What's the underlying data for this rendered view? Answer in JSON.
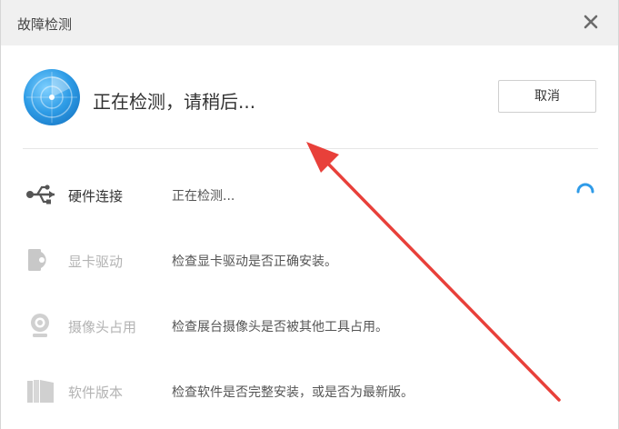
{
  "window": {
    "title": "故障检测",
    "close_icon": "close-icon"
  },
  "header": {
    "status_text": "正在检测，请稍后...",
    "cancel_label": "取消",
    "radar_icon": "radar-icon"
  },
  "checks": [
    {
      "icon": "usb-icon",
      "label": "硬件连接",
      "description": "正在检测...",
      "state": "active"
    },
    {
      "icon": "display-card-icon",
      "label": "显卡驱动",
      "description": "检查显卡驱动是否正确安装。",
      "state": "pending"
    },
    {
      "icon": "webcam-icon",
      "label": "摄像头占用",
      "description": "检查展台摄像头是否被其他工具占用。",
      "state": "pending"
    },
    {
      "icon": "software-book-icon",
      "label": "软件版本",
      "description": "检查软件是否完整安装，或是否为最新版。",
      "state": "pending"
    }
  ],
  "colors": {
    "accent": "#2f9be8",
    "annotation_arrow": "#e8403a",
    "inactive_text": "#b3b3b3"
  }
}
